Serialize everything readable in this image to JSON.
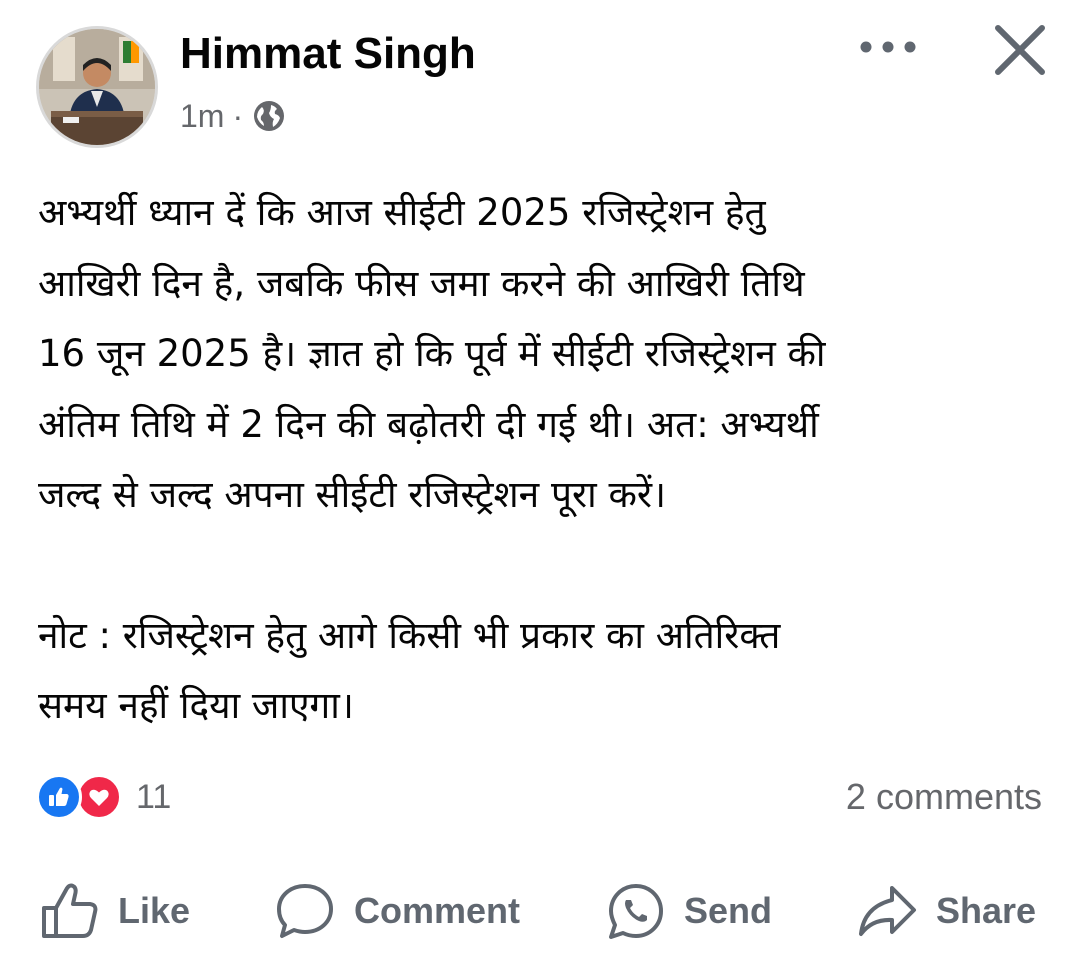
{
  "post": {
    "author": "Himmat Singh",
    "time": "1m",
    "separator": "·",
    "audience_icon": "globe-icon",
    "paragraph_lines": [
      "अभ्यर्थी ध्यान दें कि आज सीईटी 2025 रजिस्ट्रेशन हेतु",
      "आखिरी दिन है, जबकि फीस जमा करने की आखिरी तिथि",
      "16 जून 2025 है।  ज्ञात हो कि पूर्व में सीईटी रजिस्ट्रेशन की",
      "अंतिम तिथि में 2 दिन की बढ़ोतरी दी गई थी। अत: अभ्यर्थी",
      "जल्द से जल्द अपना सीईटी रजिस्ट्रेशन पूरा करें।"
    ],
    "note_lines": [
      "नोट : रजिस्ट्रेशन हेतु आगे किसी भी प्रकार का अतिरिक्त",
      "समय नहीं दिया जाएगा।"
    ]
  },
  "header_icons": {
    "more": "more-options-icon",
    "close": "close-icon"
  },
  "stats": {
    "reaction_icons": [
      "like-reaction-icon",
      "love-reaction-icon"
    ],
    "reaction_count": "11",
    "comments": "2 comments"
  },
  "actions": {
    "like": "Like",
    "comment": "Comment",
    "send": "Send",
    "share": "Share"
  },
  "colors": {
    "text": "#050505",
    "secondary": "#65676b",
    "action_text": "#606770",
    "like_blue": "#1877f2",
    "love_red": "#f02849"
  }
}
